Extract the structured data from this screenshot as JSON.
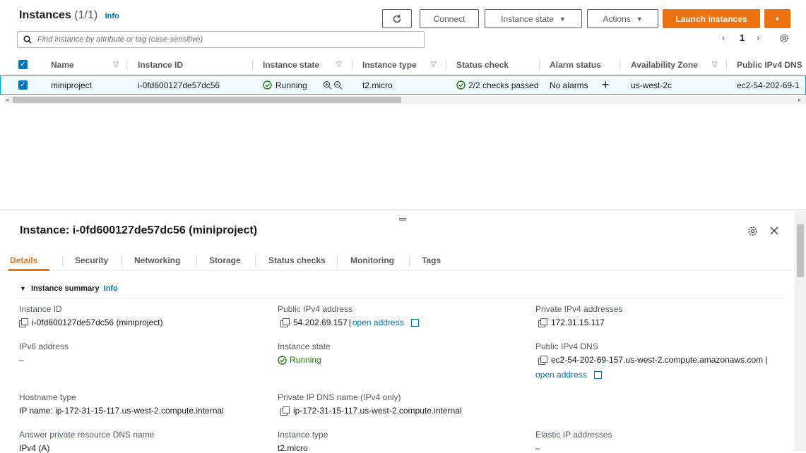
{
  "header": {
    "title": "Instances",
    "count": "(1/1)",
    "info": "Info",
    "refresh_icon": "refresh-icon",
    "connect": "Connect",
    "instance_state": "Instance state",
    "actions": "Actions",
    "launch": "Launch instances",
    "caret": "▼"
  },
  "search": {
    "placeholder": "Find instance by attribute or tag (case-sensitive)"
  },
  "pager": {
    "prev": "‹",
    "page": "1",
    "next": "›"
  },
  "table": {
    "columns": [
      "Name",
      "Instance ID",
      "Instance state",
      "Instance type",
      "Status check",
      "Alarm status",
      "Availability Zone",
      "Public IPv4 DNS"
    ],
    "row": {
      "name": "miniproject",
      "instance_id": "i-0fd600127de57dc56",
      "state": "Running",
      "type": "t2.micro",
      "status": "2/2 checks passed",
      "alarm": "No alarms",
      "alarm_add": "+",
      "zone": "us-west-2c",
      "dns": "ec2-54-202-69-1"
    }
  },
  "panel": {
    "title": "Instance: i-0fd600127de57dc56 (miniproject)",
    "tabs": [
      "Details",
      "Security",
      "Networking",
      "Storage",
      "Status checks",
      "Monitoring",
      "Tags"
    ],
    "summary": "Instance summary",
    "info": "Info"
  },
  "details": {
    "instance_id_label": "Instance ID",
    "instance_id_value": "i-0fd600127de57dc56 (miniproject)",
    "public_ipv4_label": "Public IPv4 address",
    "public_ipv4_value": "54.202.69.157",
    "public_ipv4_sep": "|",
    "open_address": "open address",
    "private_ipv4_label": "Private IPv4 addresses",
    "private_ipv4_value": "172.31.15.117",
    "ipv6_label": "IPv6 address",
    "ipv6_value": "–",
    "state_label": "Instance state",
    "state_value": "Running",
    "public_dns_label": "Public IPv4 DNS",
    "public_dns_value": "ec2-54-202-69-157.us-west-2.compute.amazonaws.com |",
    "public_dns_open": "open address",
    "hostname_label": "Hostname type",
    "hostname_value": "IP name: ip-172-31-15-117.us-west-2.compute.internal",
    "private_dns_label": "Private IP DNS name (IPv4 only)",
    "private_dns_value": "ip-172-31-15-117.us-west-2.compute.internal",
    "answer_dns_label": "Answer private resource DNS name",
    "answer_dns_value": "IPv4 (A)",
    "type_label": "Instance type",
    "type_value": "t2.micro",
    "eip_label": "Elastic IP addresses",
    "eip_value": "–"
  },
  "colors": {
    "accent": "#ec7211",
    "link": "#0073bb",
    "success": "#1d8102",
    "selected_row": "#f1faff"
  }
}
